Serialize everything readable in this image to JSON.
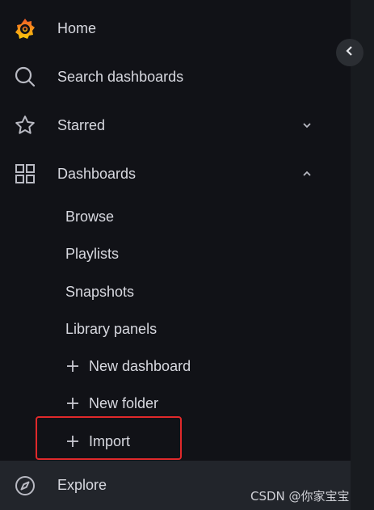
{
  "nav": {
    "home": "Home",
    "search": "Search dashboards",
    "starred": "Starred",
    "dashboards": "Dashboards",
    "explore": "Explore"
  },
  "dashboards_menu": {
    "browse": "Browse",
    "playlists": "Playlists",
    "snapshots": "Snapshots",
    "library_panels": "Library panels",
    "new_dashboard": "New dashboard",
    "new_folder": "New folder",
    "import": "Import"
  },
  "watermark": "CSDN @你家宝宝",
  "colors": {
    "background": "#111217",
    "hover": "#22252b",
    "highlight": "#e0292b",
    "logo_orange": "#f46800",
    "logo_yellow": "#fbca0a"
  }
}
